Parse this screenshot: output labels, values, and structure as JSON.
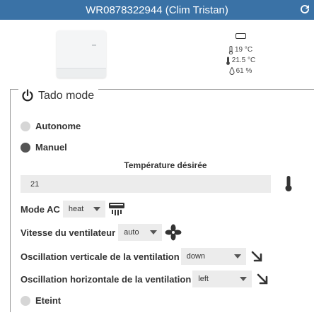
{
  "window": {
    "title": "WR0878322944 (Clim Tristan)",
    "refresh_icon": "refresh-icon"
  },
  "status": {
    "battery_icon": "battery-icon",
    "inside_temp": "19 °C",
    "outside_temp": "21.5 °C",
    "humidity": "61 %"
  },
  "tado_mode": {
    "legend": "Tado mode",
    "legend_icon": "power-icon",
    "options": [
      {
        "label": "Autonome",
        "checked": false
      },
      {
        "label": "Manuel",
        "checked": true
      },
      {
        "label": "Eteint",
        "checked": false
      }
    ]
  },
  "manual": {
    "desired_temp_label": "Température désirée",
    "desired_temp_value": "21",
    "mode_ac_label": "Mode AC",
    "mode_ac_value": "heat",
    "fan_speed_label": "Vitesse du ventilateur",
    "fan_speed_value": "auto",
    "vertical_swing_label": "Oscillation verticale de la ventilation",
    "vertical_swing_value": "down",
    "horizontal_swing_label": "Oscillation horizontale de la ventilation",
    "horizontal_swing_value": "left"
  },
  "colors": {
    "titlebar": "#3a72a6",
    "field_bg": "#ececec"
  }
}
